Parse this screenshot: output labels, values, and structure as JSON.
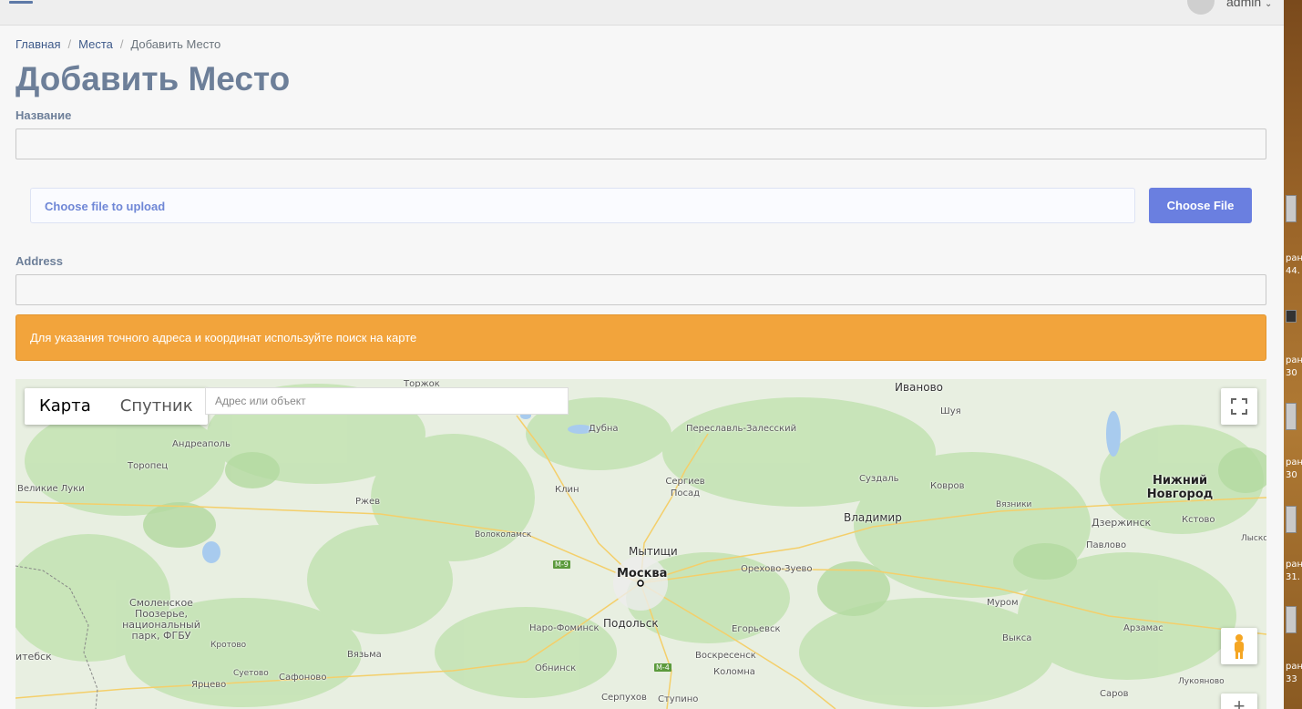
{
  "header": {
    "user_name": "admin",
    "user_caret": "⌄"
  },
  "breadcrumb": {
    "home": "Главная",
    "places": "Места",
    "current": "Добавить Место",
    "separator": "/"
  },
  "page": {
    "title": "Добавить Место"
  },
  "form": {
    "name_label": "Название",
    "name_value": "",
    "file_placeholder": "Choose file to upload",
    "file_button": "Choose File",
    "address_label": "Address",
    "address_value": "",
    "alert_text": "Для указания точного адреса и координат используйте поиск на карте"
  },
  "map": {
    "type_map": "Карта",
    "type_satellite": "Спутник",
    "search_placeholder": "Адрес или объект",
    "cities": [
      {
        "name": "Торжок"
      },
      {
        "name": "Иваново"
      },
      {
        "name": "Шуя"
      },
      {
        "name": "Дубна"
      },
      {
        "name": "Переславль-Залесский"
      },
      {
        "name": "Андреаполь"
      },
      {
        "name": "Торопец"
      },
      {
        "name": "Великие Луки"
      },
      {
        "name": "Ржев"
      },
      {
        "name": "Клин"
      },
      {
        "name": "Сергиев Посад"
      },
      {
        "name": "Суздаль"
      },
      {
        "name": "Ковров"
      },
      {
        "name": "Нижний Новгород"
      },
      {
        "name": "Вязники"
      },
      {
        "name": "Владимир"
      },
      {
        "name": "Дзержинск"
      },
      {
        "name": "Кстово"
      },
      {
        "name": "Лысков"
      },
      {
        "name": "Волоколамск"
      },
      {
        "name": "Мытищи"
      },
      {
        "name": "Москва"
      },
      {
        "name": "Орехово-Зуево"
      },
      {
        "name": "Павлово"
      },
      {
        "name": "Смоленское Поозерье, национальный парк, ФГБУ"
      },
      {
        "name": "Наро-Фоминск"
      },
      {
        "name": "Подольск"
      },
      {
        "name": "Егорьевск"
      },
      {
        "name": "Муром"
      },
      {
        "name": "Арзамас"
      },
      {
        "name": "Выкса"
      },
      {
        "name": "Кротово"
      },
      {
        "name": "Вязьма"
      },
      {
        "name": "Обнинск"
      },
      {
        "name": "Воскресенск"
      },
      {
        "name": "Коломна"
      },
      {
        "name": "Лукояново"
      },
      {
        "name": "итебск"
      },
      {
        "name": "Суетово"
      },
      {
        "name": "Сафоново"
      },
      {
        "name": "Ярцево"
      },
      {
        "name": "Серпухов"
      },
      {
        "name": "Ступино"
      },
      {
        "name": "Саров"
      }
    ],
    "shields": [
      "M-9",
      "M-4"
    ],
    "zoom_in": "+"
  },
  "desktop": {
    "labels": [
      "ран",
      "44.",
      "ран",
      "30",
      "ран",
      "30",
      "ран",
      "30",
      "ран",
      "31.",
      "ран",
      "33"
    ]
  },
  "colors": {
    "accent": "#6a7fe0",
    "alert": "#f2a43c",
    "title": "#6d7f99",
    "link": "#3e5a8a"
  }
}
